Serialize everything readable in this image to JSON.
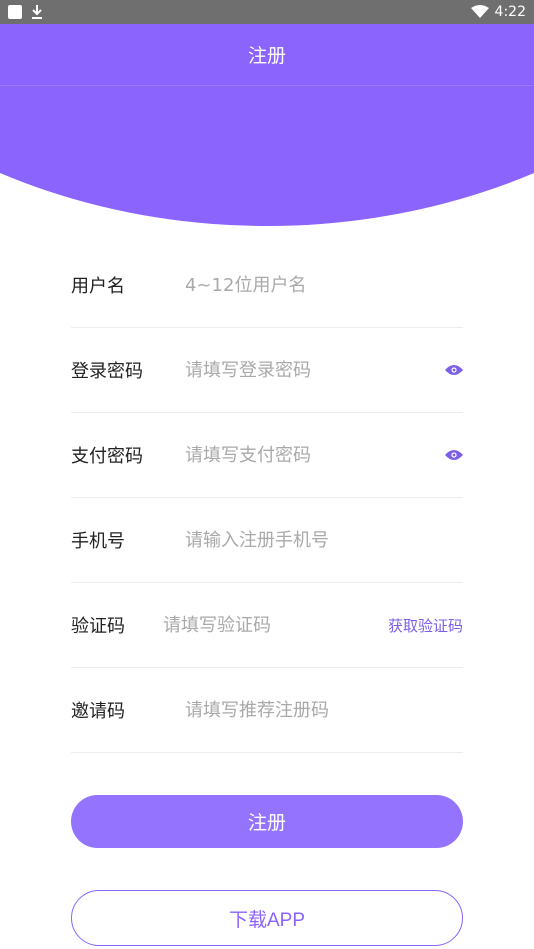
{
  "status_bar": {
    "time": "4:22"
  },
  "header": {
    "title": "注册"
  },
  "form": {
    "username": {
      "label": "用户名",
      "placeholder": "4~12位用户名"
    },
    "login_password": {
      "label": "登录密码",
      "placeholder": "请填写登录密码"
    },
    "pay_password": {
      "label": "支付密码",
      "placeholder": "请填写支付密码"
    },
    "phone": {
      "label": "手机号",
      "placeholder": "请输入注册手机号"
    },
    "code": {
      "label": "验证码",
      "placeholder": "请填写验证码",
      "get_code_label": "获取验证码"
    },
    "invite": {
      "label": "邀请码",
      "placeholder": "请填写推荐注册码"
    }
  },
  "buttons": {
    "register": "注册",
    "download": "下载APP"
  },
  "colors": {
    "primary": "#8b63fd",
    "button": "#9474fe",
    "link": "#7c5fe6"
  }
}
